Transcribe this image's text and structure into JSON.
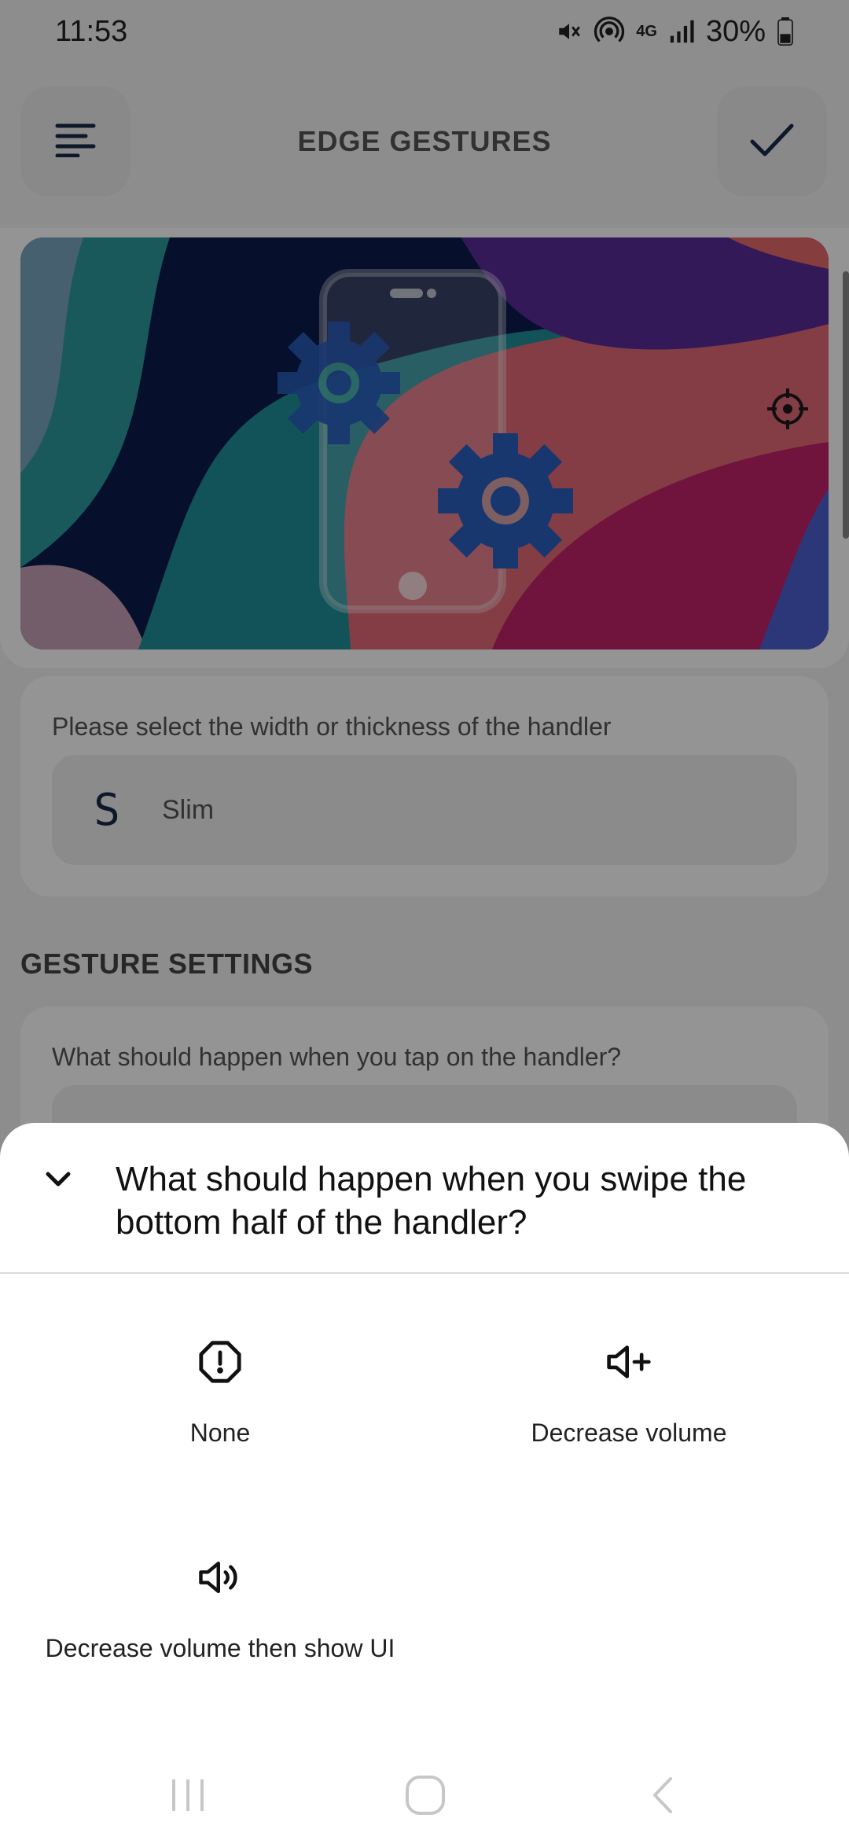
{
  "status_bar": {
    "time": "11:53",
    "battery": "30%",
    "network": "4G",
    "icons": [
      "mute-icon",
      "hotspot-icon",
      "network-4g-icon",
      "signal-icon",
      "battery-icon"
    ]
  },
  "header": {
    "title": "EDGE GESTURES",
    "menu_icon": "menu-icon",
    "confirm_icon": "check-icon"
  },
  "hero": {
    "illustration": "phone-with-gears-illustration",
    "target_icon": "crosshair-icon"
  },
  "width_card": {
    "prompt": "Please select the width or thickness of the handler",
    "selected_letter": "S",
    "selected_label": "Slim"
  },
  "gesture_settings": {
    "section_title": "GESTURE SETTINGS",
    "tap_prompt": "What should happen when you tap on the handler?"
  },
  "sheet": {
    "title": "What should happen when you swipe the bottom half of the handler?",
    "collapse_icon": "chevron-down-icon",
    "options": [
      {
        "label": "None",
        "icon": "alert-octagon-icon"
      },
      {
        "label": "Decrease volume",
        "icon": "volume-plus-icon"
      },
      {
        "label": "Decrease volume then show UI",
        "icon": "volume-up-icon"
      }
    ]
  },
  "nav_bar": {
    "icons": [
      "recents-icon",
      "home-icon",
      "back-icon"
    ]
  },
  "colors": {
    "navy": "#1b2a4a",
    "scrim": "rgba(0,0,0,0.42)",
    "sheet_bg": "#ffffff"
  }
}
